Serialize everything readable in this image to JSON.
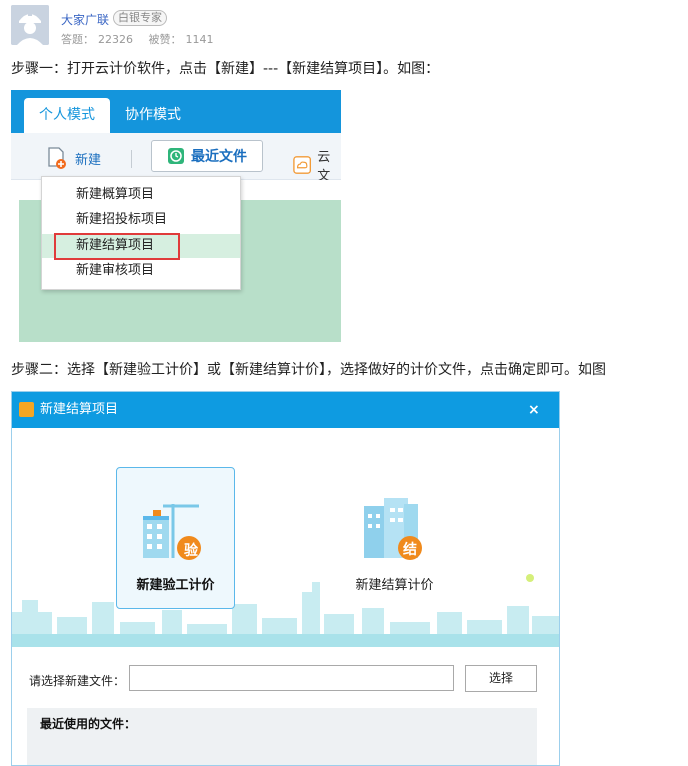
{
  "user": {
    "name": "大家广联",
    "badge": "白银专家",
    "answers_label": "答题：",
    "answers": "22326",
    "likes_label": "被赞：",
    "likes": "1141"
  },
  "step1": "步骤一：打开云计价软件，点击【新建】---【新建结算项目】。如图：",
  "step2": "步骤二：选择【新建验工计价】或【新建结算计价】，选择做好的计价文件，点击确定即可。如图",
  "shot1": {
    "tab_active": "个人模式",
    "tab_other": "协作模式",
    "new_label": "新建",
    "recent_label": "最近文件",
    "cloud_label": "云文",
    "menu": [
      "新建概算项目",
      "新建招投标项目",
      "新建结算项目",
      "新建审核项目"
    ]
  },
  "dialog": {
    "title": "新建结算项目",
    "close": "×",
    "option1": "新建验工计价",
    "option1_badge": "验",
    "option2": "新建结算计价",
    "option2_badge": "结",
    "file_label": "请选择新建文件：",
    "select_button": "选择",
    "recent_files_title": "最近使用的文件："
  },
  "colors": {
    "accent": "#0e9be1",
    "link": "#3a66c4",
    "highlight_border": "#e03b3b",
    "badge_orange": "#f08a1c"
  }
}
